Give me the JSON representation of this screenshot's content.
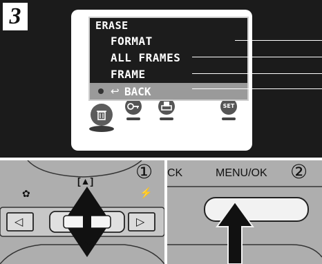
{
  "step": {
    "number": "3"
  },
  "menu": {
    "title": "ERASE",
    "items": [
      {
        "label": "FORMAT"
      },
      {
        "label": "ALL FRAMES"
      },
      {
        "label": "FRAME"
      }
    ],
    "back_label": "BACK",
    "back_arrow": "↩"
  },
  "icons": [
    {
      "name": "trash-icon",
      "glyph": "🗑",
      "selected": true
    },
    {
      "name": "key-icon",
      "glyph": "O┐",
      "selected": false
    },
    {
      "name": "print-icon",
      "glyph": "⎙",
      "selected": false
    },
    {
      "name": "set-icon",
      "glyph": "SET",
      "selected": false
    }
  ],
  "dpad": {
    "macro_symbol": "✿",
    "flash_symbol": "⚡",
    "top_symbol": "[▲]",
    "bottom_symbol": "▲▲▲",
    "left_arrow": "◁",
    "right_arrow": "▷"
  },
  "callouts": {
    "one": "①",
    "two": "②"
  },
  "right_panel": {
    "partial_label": "CK",
    "menu_ok_label": "MENU/OK"
  },
  "colors": {
    "screen_bg": "#1b1b1b",
    "camera_body": "#aeaeae",
    "highlight": "#9a9a9a"
  }
}
